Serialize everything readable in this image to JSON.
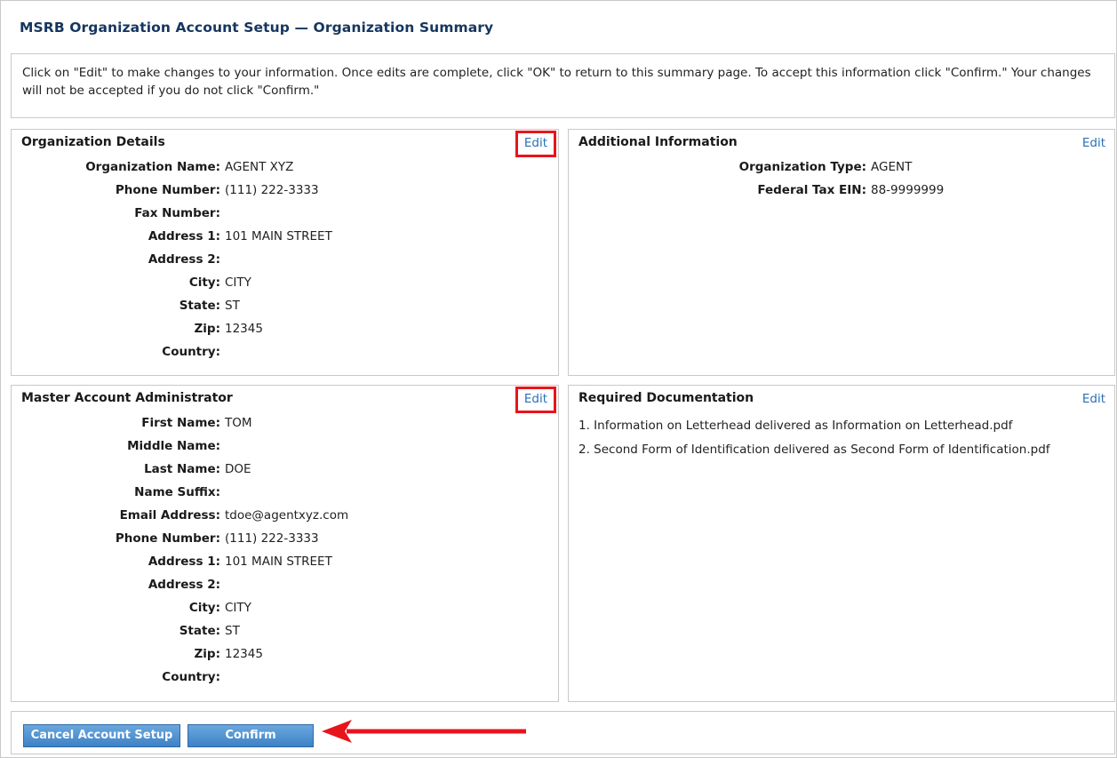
{
  "page": {
    "title": "MSRB Organization Account Setup — Organization Summary",
    "instructions": "Click on \"Edit\" to make changes to your information. Once edits are complete, click \"OK\" to return to this summary page. To accept this information click \"Confirm.\" Your changes will not be accepted if you do not click \"Confirm.\""
  },
  "org_details": {
    "title": "Organization Details",
    "edit_label": "Edit",
    "fields": [
      {
        "label": "Organization Name:",
        "value": "AGENT XYZ"
      },
      {
        "label": "Phone Number:",
        "value": "(111) 222-3333"
      },
      {
        "label": "Fax Number:",
        "value": ""
      },
      {
        "label": "Address 1:",
        "value": "101 MAIN STREET"
      },
      {
        "label": "Address 2:",
        "value": ""
      },
      {
        "label": "City:",
        "value": "CITY"
      },
      {
        "label": "State:",
        "value": "ST"
      },
      {
        "label": "Zip:",
        "value": "12345"
      },
      {
        "label": "Country:",
        "value": ""
      }
    ]
  },
  "additional_info": {
    "title": "Additional Information",
    "edit_label": "Edit",
    "fields": [
      {
        "label": "Organization Type:",
        "value": "AGENT"
      },
      {
        "label": "Federal Tax EIN:",
        "value": "88-9999999"
      }
    ]
  },
  "master_admin": {
    "title": "Master Account Administrator",
    "edit_label": "Edit",
    "fields": [
      {
        "label": "First Name:",
        "value": "TOM"
      },
      {
        "label": "Middle Name:",
        "value": ""
      },
      {
        "label": "Last Name:",
        "value": "DOE"
      },
      {
        "label": "Name Suffix:",
        "value": ""
      },
      {
        "label": "Email Address:",
        "value": "tdoe@agentxyz.com"
      },
      {
        "label": "Phone Number:",
        "value": "(111) 222-3333"
      },
      {
        "label": "Address 1:",
        "value": "101 MAIN STREET"
      },
      {
        "label": "Address 2:",
        "value": ""
      },
      {
        "label": "City:",
        "value": "CITY"
      },
      {
        "label": "State:",
        "value": "ST"
      },
      {
        "label": "Zip:",
        "value": "12345"
      },
      {
        "label": "Country:",
        "value": ""
      }
    ]
  },
  "required_docs": {
    "title": "Required Documentation",
    "edit_label": "Edit",
    "items": [
      "1. Information on Letterhead delivered as Information on Letterhead.pdf",
      "2. Second Form of Identification delivered as Second Form of Identification.pdf"
    ]
  },
  "footer": {
    "cancel_label": "Cancel Account Setup",
    "confirm_label": "Confirm"
  },
  "colors": {
    "title": "#15365f",
    "link": "#2a6fb5",
    "highlight": "#e8141c",
    "button": "#3e82c6"
  }
}
